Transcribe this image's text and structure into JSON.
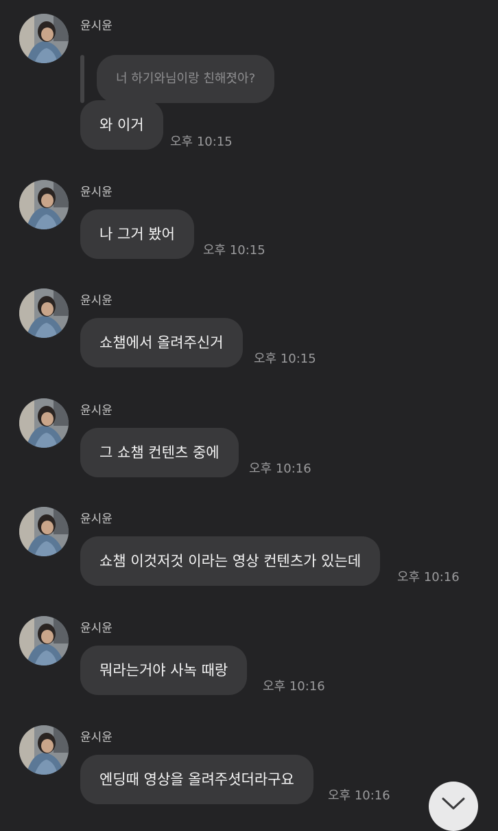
{
  "chat": {
    "reply_quote": "너 하기와님이랑 친해졋아?",
    "messages": [
      {
        "sender": "윤시윤",
        "text": "와 이거",
        "time": "오후 10:15"
      },
      {
        "sender": "윤시윤",
        "text": "나 그거 봤어",
        "time": "오후 10:15"
      },
      {
        "sender": "윤시윤",
        "text": "쇼챔에서 올려주신거",
        "time": "오후 10:15"
      },
      {
        "sender": "윤시윤",
        "text": "그 쇼챔 컨텐츠 중에",
        "time": "오후 10:16"
      },
      {
        "sender": "윤시윤",
        "text": "쇼챔 이것저것 이라는 영상 컨텐츠가 있는데",
        "time": "오후 10:16"
      },
      {
        "sender": "윤시윤",
        "text": "뭐라는거야 사녹 때랑",
        "time": "오후 10:16"
      },
      {
        "sender": "윤시윤",
        "text": "엔딩때 영상을 올려주셧더라구요",
        "time": "오후 10:16"
      }
    ]
  },
  "icons": {
    "avatar": "profile-photo",
    "scroll_down": "chevron-down-icon"
  },
  "colors": {
    "background": "#232325",
    "bubble": "#39393b",
    "timestamp": "#9b9b9d",
    "scroll_button": "#e9e9ea"
  }
}
